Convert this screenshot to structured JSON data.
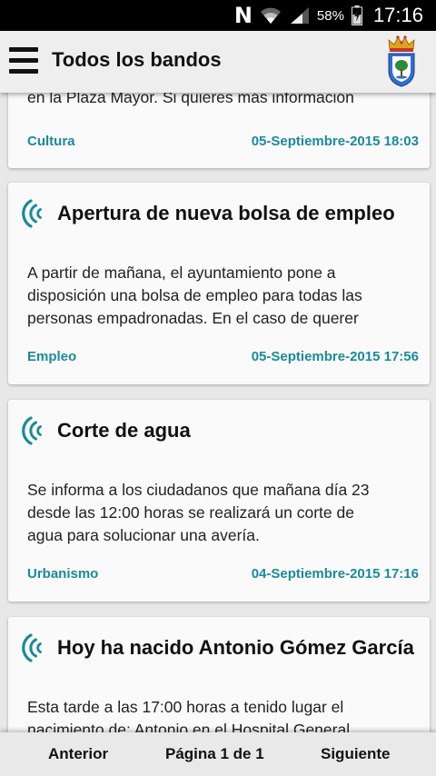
{
  "status_bar": {
    "notification_letter": "N",
    "battery": "58%",
    "time": "17:16"
  },
  "app_bar": {
    "title": "Todos los bandos"
  },
  "icons": {
    "menu": "hamburger-menu-icon",
    "crest": "municipal-crest-icon",
    "signal": "broadcast-signal-icon"
  },
  "colors": {
    "accent": "#1b8a9a",
    "card_background": "#fafafa",
    "screen_background": "#e8e8e8"
  },
  "cards": [
    {
      "title": "",
      "body_lines": [
        "en la Plaza Mayor. Si quieres más información"
      ],
      "category": "Cultura",
      "date": "05-Septiembre-2015 18:03"
    },
    {
      "title": "Apertura de nueva bolsa de empleo",
      "body_lines": [
        "A partir de mañana, el ayuntamiento pone a",
        "disposición una bolsa de empleo para todas las",
        "personas empadronadas. En el caso de querer"
      ],
      "category": "Empleo",
      "date": "05-Septiembre-2015 17:56"
    },
    {
      "title": "Corte de agua",
      "body_lines": [
        "Se informa a los ciudadanos que mañana día 23",
        "desde las 12:00 horas se realizará un corte de",
        "agua para solucionar una avería."
      ],
      "category": "Urbanismo",
      "date": "04-Septiembre-2015 17:16"
    },
    {
      "title": "Hoy ha nacido Antonio Gómez García",
      "body_lines": [
        "Esta tarde a las 17:00 horas a tenido lugar el",
        "nacimiento de: Antonio en el Hospital General"
      ],
      "category": "",
      "date": ""
    }
  ],
  "pager": {
    "previous": "Anterior",
    "page_label": "Página 1 de 1",
    "next": "Siguiente"
  }
}
